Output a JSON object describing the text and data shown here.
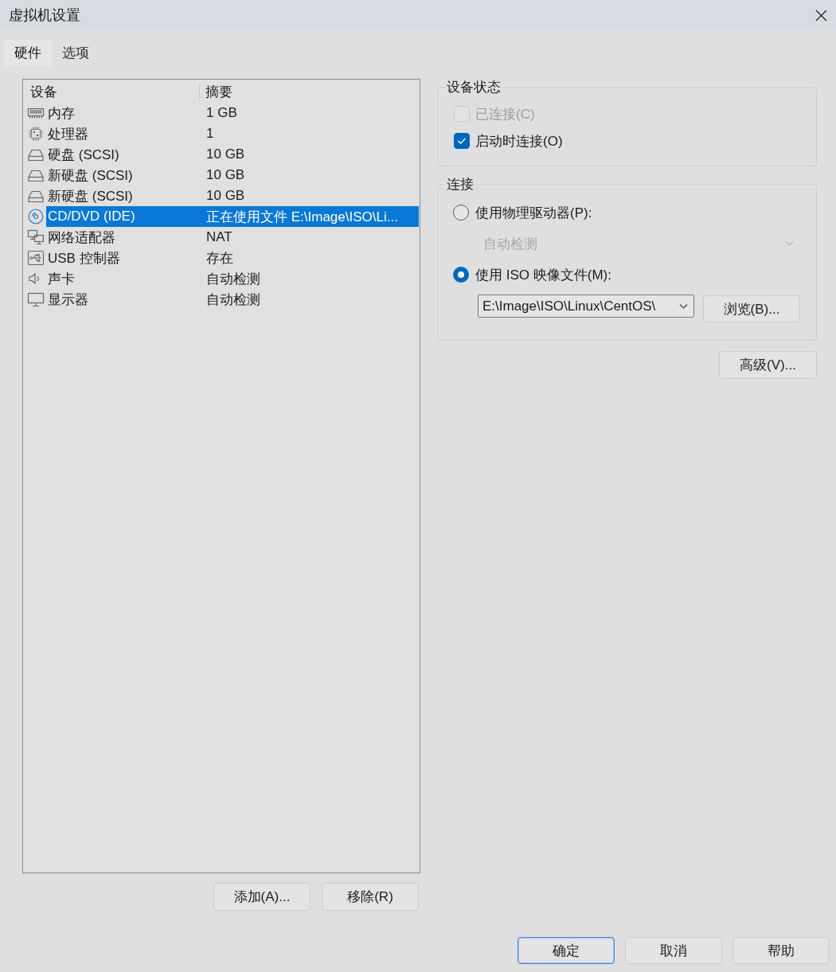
{
  "window": {
    "title": "虚拟机设置"
  },
  "tabs": [
    {
      "label": "硬件",
      "selected": true
    },
    {
      "label": "选项",
      "selected": false
    }
  ],
  "device_list": {
    "columns": [
      "设备",
      "摘要"
    ],
    "rows": [
      {
        "kind": "memory",
        "device": "内存",
        "summary": "1 GB",
        "selected": false
      },
      {
        "kind": "processor",
        "device": "处理器",
        "summary": "1",
        "selected": false
      },
      {
        "kind": "disk",
        "device": "硬盘 (SCSI)",
        "summary": "10 GB",
        "selected": false
      },
      {
        "kind": "disk",
        "device": "新硬盘 (SCSI)",
        "summary": "10 GB",
        "selected": false
      },
      {
        "kind": "disk",
        "device": "新硬盘 (SCSI)",
        "summary": "10 GB",
        "selected": false
      },
      {
        "kind": "cd",
        "device": "CD/DVD (IDE)",
        "summary": "正在使用文件 E:\\Image\\ISO\\Li...",
        "selected": true
      },
      {
        "kind": "network",
        "device": "网络适配器",
        "summary": "NAT",
        "selected": false
      },
      {
        "kind": "usb",
        "device": "USB 控制器",
        "summary": "存在",
        "selected": false
      },
      {
        "kind": "sound",
        "device": "声卡",
        "summary": "自动检测",
        "selected": false
      },
      {
        "kind": "display",
        "device": "显示器",
        "summary": "自动检测",
        "selected": false
      }
    ]
  },
  "list_buttons": [
    "添加(A)...",
    "移除(R)"
  ],
  "device_status": {
    "title": "设备状态",
    "options": [
      {
        "label": "已连接(C)",
        "checked": false,
        "disabled": true
      },
      {
        "label": "启动时连接(O)",
        "checked": true,
        "disabled": false
      }
    ]
  },
  "connection": {
    "title": "连接",
    "options": [
      {
        "kind": "physical",
        "label": "使用物理驱动器(P):",
        "selected": false,
        "drive": {
          "value": "自动检测",
          "disabled": true
        }
      },
      {
        "kind": "iso",
        "label": "使用 ISO 映像文件(M):",
        "selected": true,
        "path": "E:\\Image\\ISO\\Linux\\CentOS\\",
        "browse_button": "浏览(B)..."
      }
    ]
  },
  "advanced_button": "高级(V)...",
  "footer_buttons": [
    {
      "label": "确定",
      "default": true
    },
    {
      "label": "取消",
      "default": false
    },
    {
      "label": "帮助",
      "default": false
    }
  ]
}
